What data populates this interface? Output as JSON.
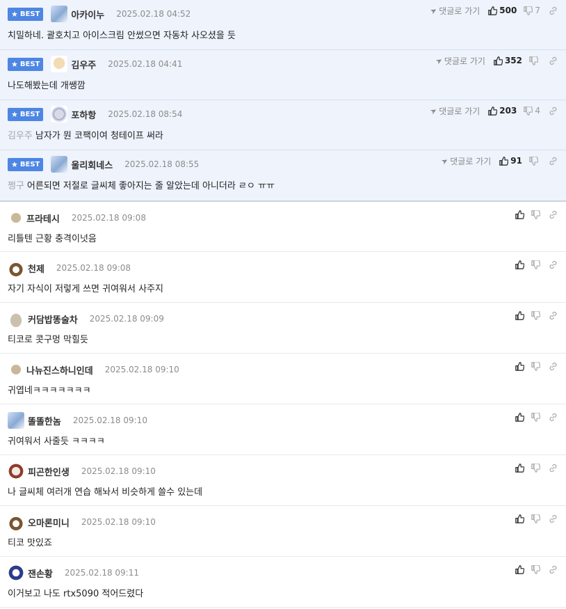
{
  "ui": {
    "badge_label": "BEST",
    "goto_label": "댓글로 가기"
  },
  "best_comments": [
    {
      "nick": "아카이누",
      "date": "2025.02.18 04:52",
      "mention": "",
      "text": "치밀하네. 괄호치고 아이스크림 안썼으면 자동차 사오셨을 듯",
      "likes": "500",
      "dislikes": "7",
      "avatar": "cat-avatar"
    },
    {
      "nick": "김우주",
      "date": "2025.02.18 04:41",
      "mention": "",
      "text": "나도해봤는데 개쌩깜",
      "likes": "352",
      "dislikes": "",
      "avatar": "dog-avatar"
    },
    {
      "nick": "포하항",
      "date": "2025.02.18 08:54",
      "mention": "김우주",
      "text": "남자가 뭔 코팩이여 청테이프 써라",
      "likes": "203",
      "dislikes": "4",
      "avatar": "dog2-avatar"
    },
    {
      "nick": "울리회네스",
      "date": "2025.02.18 08:55",
      "mention": "쩡구",
      "text": "어른되면 저절로 글씨체 좋아지는 줄 알았는데 아니더라 ㄹㅇ ㅠㅠ",
      "likes": "91",
      "dislikes": "",
      "avatar": "cat-avatar"
    }
  ],
  "comments": [
    {
      "nick": "프라테시",
      "date": "2025.02.18 09:08",
      "text": "리틀텐 근황 충격이넛음",
      "avatar": "dot-avatar"
    },
    {
      "nick": "천제",
      "date": "2025.02.18 09:08",
      "text": "자기 자식이 저렇게 쓰면 귀여워서 사주지",
      "avatar": "fox-avatar"
    },
    {
      "nick": "커담밥똥술차",
      "date": "2025.02.18 09:09",
      "text": "티코로 콧구멍 막힐듯",
      "avatar": "blob-avatar"
    },
    {
      "nick": "나뉴진스하니인데",
      "date": "2025.02.18 09:10",
      "text": "귀엽네ㅋㅋㅋㅋㅋㅋㅋ",
      "avatar": "dot-avatar"
    },
    {
      "nick": "똘똘한놈",
      "date": "2025.02.18 09:10",
      "text": "귀여워서 사줄듯 ㅋㅋㅋㅋ",
      "avatar": "cat-avatar"
    },
    {
      "nick": "피곤한인생",
      "date": "2025.02.18 09:10",
      "text": "나 글씨체 여러개 연습 해놔서 비슷하게 쓸수 있는데",
      "avatar": "red-avatar"
    },
    {
      "nick": "오마론미니",
      "date": "2025.02.18 09:10",
      "text": "티코 맛있죠",
      "avatar": "fox-avatar"
    },
    {
      "nick": "잰손황",
      "date": "2025.02.18 09:11",
      "text": "이거보고 나도 rtx5090 적어드렸다",
      "avatar": "brown-avatar"
    }
  ]
}
